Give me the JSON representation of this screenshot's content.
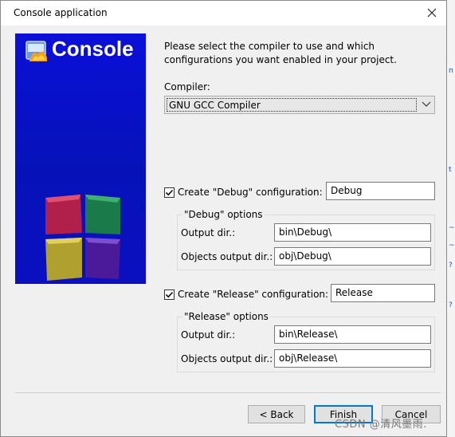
{
  "window": {
    "title": "Console application"
  },
  "banner": {
    "title": "Console"
  },
  "intro": "Please select the compiler to use and which configurations you want enabled in your project.",
  "compiler": {
    "label": "Compiler:",
    "selected": "GNU GCC Compiler"
  },
  "debug": {
    "checkbox_label": "Create \"Debug\" configuration:",
    "checked": true,
    "name": "Debug",
    "group_title": "\"Debug\" options",
    "output_label": "Output dir.:",
    "output_value": "bin\\Debug\\",
    "objects_label": "Objects output dir.:",
    "objects_value": "obj\\Debug\\"
  },
  "release": {
    "checkbox_label": "Create \"Release\" configuration:",
    "checked": true,
    "name": "Release",
    "group_title": "\"Release\" options",
    "output_label": "Output dir.:",
    "output_value": "bin\\Release\\",
    "objects_label": "Objects output dir.:",
    "objects_value": "obj\\Release\\"
  },
  "buttons": {
    "back": "< Back",
    "finish": "Finish",
    "cancel": "Cancel"
  },
  "watermark": "CSDN @清风墨雨.",
  "background_links": [
    "п",
    "t",
    "~1",
    "~",
    "?",
    "?"
  ],
  "colors": {
    "banner_blue": "#0a10d8",
    "focus_blue": "#0078d7"
  }
}
